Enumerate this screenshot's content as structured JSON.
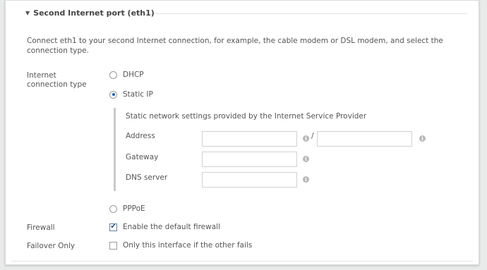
{
  "section": {
    "title": "Second Internet port (eth1)",
    "description": "Connect eth1 to your second Internet connection, for example, the cable modem or DSL modem, and select the connection type."
  },
  "connection_type": {
    "label": "Internet connection type",
    "options": [
      {
        "label": "DHCP",
        "selected": false
      },
      {
        "label": "Static IP",
        "selected": true
      },
      {
        "label": "PPPoE",
        "selected": false
      }
    ]
  },
  "static_ip": {
    "description": "Static network settings provided by the Internet Service Provider",
    "fields": [
      {
        "label": "Address",
        "value": ""
      },
      {
        "label": "Gateway",
        "value": ""
      },
      {
        "label": "DNS server",
        "value": ""
      }
    ],
    "separator": "/",
    "info_icon": "i"
  },
  "firewall": {
    "label": "Firewall",
    "option": "Enable the default firewall",
    "checked": true
  },
  "failover": {
    "label": "Failover Only",
    "option": "Only this interface if the other fails",
    "checked": false
  },
  "colors": {
    "accent": "#2a5d9f",
    "panel": "#ffffff",
    "background": "#e9eaea"
  }
}
